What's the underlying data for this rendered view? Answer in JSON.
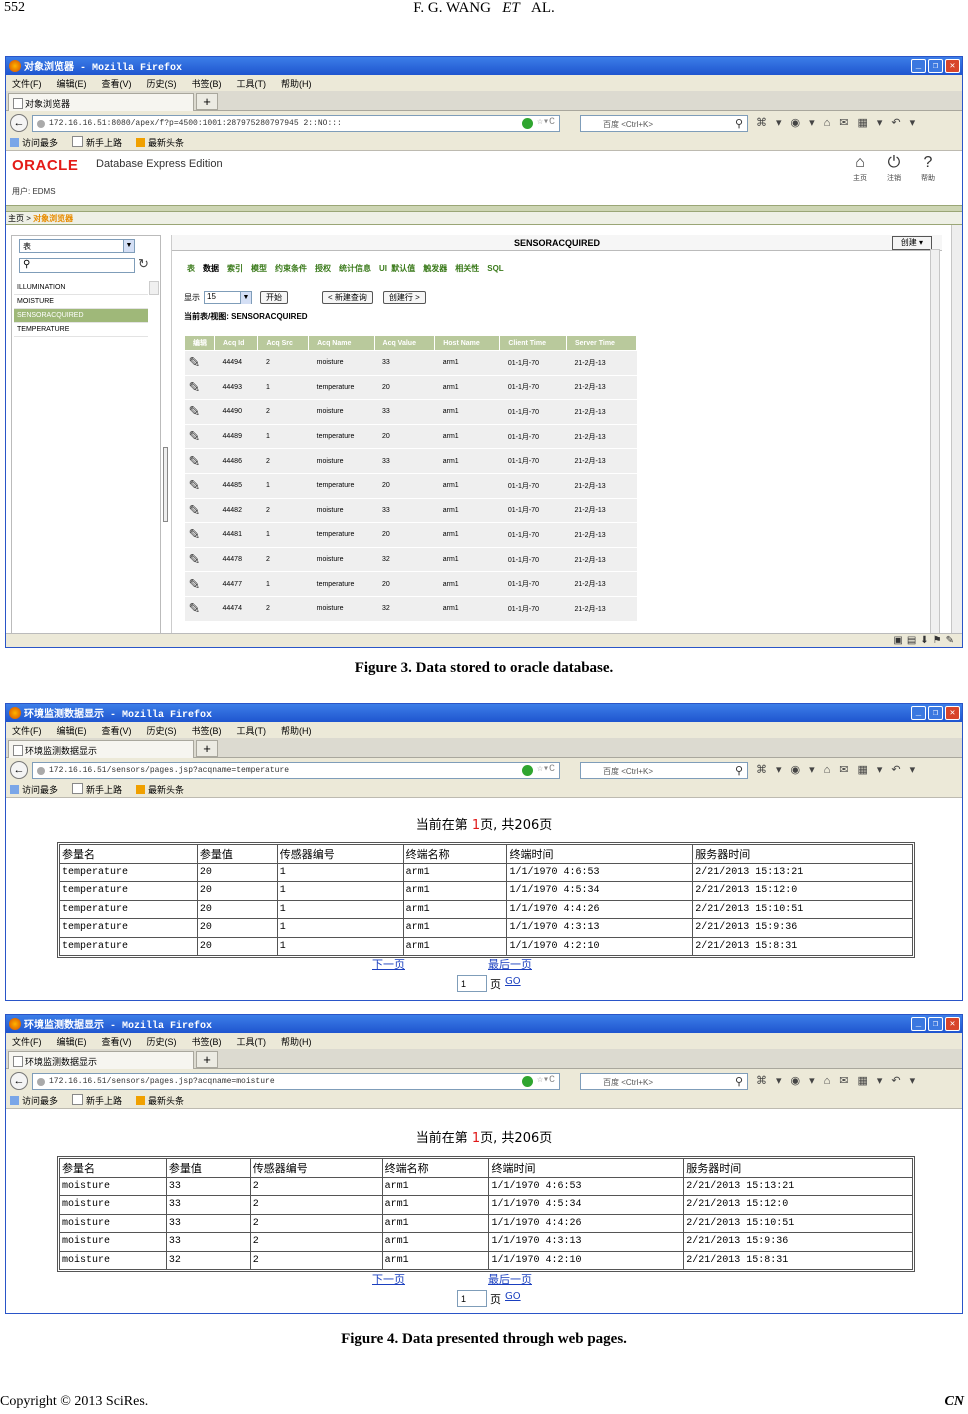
{
  "header": {
    "page_number": "552",
    "authors": "F. G. WANG",
    "et": "ET",
    "al": "AL."
  },
  "browser": {
    "menu": [
      "文件(F)",
      "编辑(E)",
      "查看(V)",
      "历史(S)",
      "书签(B)",
      "工具(T)",
      "帮助(H)"
    ],
    "search_placeholder": "百度 <Ctrl+K>",
    "bookmarks": [
      "访问最多",
      "新手上路",
      "最新头条"
    ]
  },
  "fig3": {
    "window_title": "对象浏览器 - Mozilla Firefox",
    "tab": "对象浏览器",
    "url": "172.16.16.51:8080/apex/f?p=4500:1001:287975280797945 2::NO:::",
    "logo": "ORACLE",
    "edition": "Database Express Edition",
    "user": "用户: EDMS",
    "icons": {
      "home": "主页",
      "logout": "注销",
      "help": "帮助"
    },
    "crumb_home": "主页",
    "crumb_sep": " > ",
    "crumb_current": "对象浏览器",
    "type_select": "表",
    "objects": [
      "ILLUMINATION",
      "MOISTURE",
      "SENSORACQUIRED",
      "TEMPERATURE"
    ],
    "panel_title": "SENSORACQUIRED",
    "create_button": "创建",
    "tabs": [
      "表",
      "数据",
      "索引",
      "模型",
      "约束条件",
      "授权",
      "统计信息",
      "UI 默认值",
      "触发器",
      "相关性",
      "SQL"
    ],
    "show_label": "显示",
    "show_value": "15",
    "go_button": "开始",
    "new_query_button": "< 新建查询",
    "create_row_button": "创建行 >",
    "current_table": "当前表/视图: SENSORACQUIRED",
    "columns": [
      "编辑",
      "Acq Id",
      "Acq Src",
      "Acq Name",
      "Acq Value",
      "Host Name",
      "Client Time",
      "Server Time"
    ],
    "rows": [
      [
        "44494",
        "2",
        "moisture",
        "33",
        "arm1",
        "01-1月-70",
        "21-2月-13"
      ],
      [
        "44493",
        "1",
        "temperature",
        "20",
        "arm1",
        "01-1月-70",
        "21-2月-13"
      ],
      [
        "44490",
        "2",
        "moisture",
        "33",
        "arm1",
        "01-1月-70",
        "21-2月-13"
      ],
      [
        "44489",
        "1",
        "temperature",
        "20",
        "arm1",
        "01-1月-70",
        "21-2月-13"
      ],
      [
        "44486",
        "2",
        "moisture",
        "33",
        "arm1",
        "01-1月-70",
        "21-2月-13"
      ],
      [
        "44485",
        "1",
        "temperature",
        "20",
        "arm1",
        "01-1月-70",
        "21-2月-13"
      ],
      [
        "44482",
        "2",
        "moisture",
        "33",
        "arm1",
        "01-1月-70",
        "21-2月-13"
      ],
      [
        "44481",
        "1",
        "temperature",
        "20",
        "arm1",
        "01-1月-70",
        "21-2月-13"
      ],
      [
        "44478",
        "2",
        "moisture",
        "32",
        "arm1",
        "01-1月-70",
        "21-2月-13"
      ],
      [
        "44477",
        "1",
        "temperature",
        "20",
        "arm1",
        "01-1月-70",
        "21-2月-13"
      ],
      [
        "44474",
        "2",
        "moisture",
        "32",
        "arm1",
        "01-1月-70",
        "21-2月-13"
      ]
    ],
    "caption": "Figure 3. Data stored to oracle database."
  },
  "fig4a": {
    "window_title": "环境监测数据显示 - Mozilla Firefox",
    "tab": "环境监测数据显示",
    "url": "172.16.16.51/sensors/pages.jsp?acqname=temperature",
    "page_prefix": "当前在第 ",
    "page_num": "1",
    "page_suffix": "页, 共206页",
    "columns": [
      "参量名",
      "参量值",
      "传感器编号",
      "终端名称",
      "终端时间",
      "服务器时间"
    ],
    "rows": [
      [
        "temperature",
        "20",
        "1",
        "arm1",
        "1/1/1970 4:6:53",
        "2/21/2013 15:13:21"
      ],
      [
        "temperature",
        "20",
        "1",
        "arm1",
        "1/1/1970 4:5:34",
        "2/21/2013 15:12:0"
      ],
      [
        "temperature",
        "20",
        "1",
        "arm1",
        "1/1/1970 4:4:26",
        "2/21/2013 15:10:51"
      ],
      [
        "temperature",
        "20",
        "1",
        "arm1",
        "1/1/1970 4:3:13",
        "2/21/2013 15:9:36"
      ],
      [
        "temperature",
        "20",
        "1",
        "arm1",
        "1/1/1970 4:2:10",
        "2/21/2013 15:8:31"
      ]
    ],
    "next": "下一页",
    "last": "最后一页",
    "page_input": "1",
    "page_label": "页",
    "go": "GO"
  },
  "fig4b": {
    "window_title": "环境监测数据显示 - Mozilla Firefox",
    "tab": "环境监测数据显示",
    "url": "172.16.16.51/sensors/pages.jsp?acqname=moisture",
    "page_prefix": "当前在第 ",
    "page_num": "1",
    "page_suffix": "页, 共206页",
    "columns": [
      "参量名",
      "参量值",
      "传感器编号",
      "终端名称",
      "终端时间",
      "服务器时间"
    ],
    "rows": [
      [
        "moisture",
        "33",
        "2",
        "arm1",
        "1/1/1970 4:6:53",
        "2/21/2013 15:13:21"
      ],
      [
        "moisture",
        "33",
        "2",
        "arm1",
        "1/1/1970 4:5:34",
        "2/21/2013 15:12:0"
      ],
      [
        "moisture",
        "33",
        "2",
        "arm1",
        "1/1/1970 4:4:26",
        "2/21/2013 15:10:51"
      ],
      [
        "moisture",
        "33",
        "2",
        "arm1",
        "1/1/1970 4:3:13",
        "2/21/2013 15:9:36"
      ],
      [
        "moisture",
        "32",
        "2",
        "arm1",
        "1/1/1970 4:2:10",
        "2/21/2013 15:8:31"
      ]
    ],
    "next": "下一页",
    "last": "最后一页",
    "page_input": "1",
    "page_label": "页",
    "go": "GO",
    "caption": "Figure 4. Data presented through web pages."
  },
  "footer": {
    "copyright": "Copyright © 2013 SciRes.",
    "journal": "CN"
  }
}
